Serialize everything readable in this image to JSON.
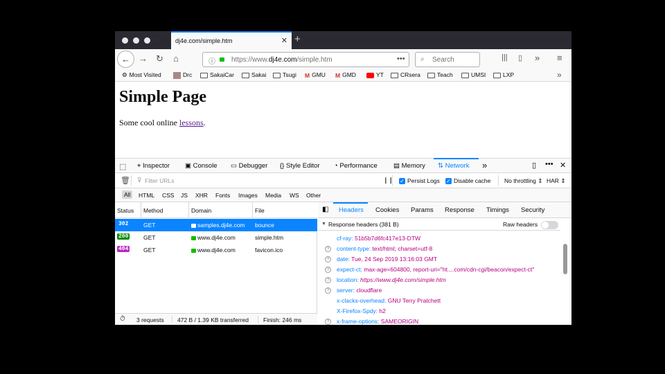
{
  "browser": {
    "tab_title": "dj4e.com/simple.htm",
    "url_prefix": "https://www.",
    "url_host": "dj4e.com",
    "url_path": "/simple.htm",
    "search_placeholder": "Search"
  },
  "bookmarks": [
    {
      "label": "Most Visited",
      "icon": "gear-icon"
    },
    {
      "label": "Drc",
      "icon": "avatar-icon"
    },
    {
      "label": "SakaiCar",
      "icon": "folder-icon"
    },
    {
      "label": "Sakai",
      "icon": "folder-icon"
    },
    {
      "label": "Tsugi",
      "icon": "folder-icon"
    },
    {
      "label": "GMU",
      "icon": "gmail-icon"
    },
    {
      "label": "GMD",
      "icon": "gmail-icon"
    },
    {
      "label": "YT",
      "icon": "youtube-icon"
    },
    {
      "label": "CRsera",
      "icon": "folder-icon"
    },
    {
      "label": "Teach",
      "icon": "folder-icon"
    },
    {
      "label": "UMSI",
      "icon": "folder-icon"
    },
    {
      "label": "LXP",
      "icon": "folder-icon"
    }
  ],
  "page": {
    "heading": "Simple Page",
    "text_before": "Some cool online ",
    "link": "lessons",
    "text_after": "."
  },
  "devtools": {
    "tabs": [
      "Inspector",
      "Console",
      "Debugger",
      "Style Editor",
      "Performance",
      "Memory",
      "Network"
    ],
    "active_tab": "Network",
    "filter_placeholder": "Filter URLs",
    "persist_logs": "Persist Logs",
    "disable_cache": "Disable cache",
    "throttling": "No throttling",
    "har": "HAR",
    "types": [
      "All",
      "HTML",
      "CSS",
      "JS",
      "XHR",
      "Fonts",
      "Images",
      "Media",
      "WS",
      "Other"
    ],
    "columns": {
      "status": "Status",
      "method": "Method",
      "domain": "Domain",
      "file": "File"
    },
    "requests": [
      {
        "status": "302",
        "method": "GET",
        "domain": "samples.dj4e.com",
        "file": "bounce",
        "color": "#0a84ff"
      },
      {
        "status": "200",
        "method": "GET",
        "domain": "www.dj4e.com",
        "file": "simple.htm",
        "color": "#058b00"
      },
      {
        "status": "404",
        "method": "GET",
        "domain": "www.dj4e.com",
        "file": "favicon.ico",
        "color": "#b82cbf"
      }
    ],
    "detail_tabs": [
      "Headers",
      "Cookies",
      "Params",
      "Response",
      "Timings",
      "Security"
    ],
    "response_headers_title": "Response headers (381 B)",
    "raw_headers": "Raw headers",
    "headers": [
      {
        "name": "cf-ray:",
        "value": "51b5b7d6fc417e13-DTW",
        "help": false
      },
      {
        "name": "content-type:",
        "value": "text/html; charset=utf-8",
        "help": true
      },
      {
        "name": "date:",
        "value": "Tue, 24 Sep 2019 13:16:03 GMT",
        "help": true
      },
      {
        "name": "expect-ct:",
        "value": "max-age=604800, report-uri=\"ht....com/cdn-cgi/beacon/expect-ct\"",
        "help": true
      },
      {
        "name": "location:",
        "value": "https://www.dj4e.com/simple.htm",
        "help": true
      },
      {
        "name": "server:",
        "value": "cloudflare",
        "help": true
      },
      {
        "name": "x-clacks-overhead:",
        "value": "GNU Terry Pratchett",
        "help": false
      },
      {
        "name": "X-Firefox-Spdy:",
        "value": "h2",
        "help": false
      },
      {
        "name": "x-frame-options:",
        "value": "SAMEORIGIN",
        "help": true
      }
    ],
    "status_bar": {
      "requests": "3 requests",
      "transferred": "472 B / 1.39 KB transferred",
      "finish": "Finish: 246 ms"
    }
  }
}
